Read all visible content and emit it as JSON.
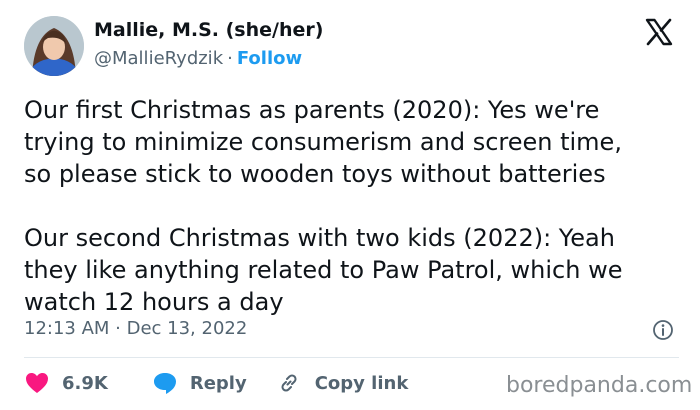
{
  "author": {
    "display_name": "Mallie, M.S. (she/her)",
    "handle": "@MallieRydzik",
    "separator": "·",
    "follow_label": "Follow"
  },
  "tweet": {
    "text": "Our first Christmas as parents (2020): Yes we're\ntrying to minimize consumerism and screen time,\nso please stick to wooden toys without batteries\n\nOur second Christmas with two kids (2022): Yeah\nthey like anything related to Paw Patrol, which we\nwatch 12 hours a day",
    "timestamp": "12:13 AM · Dec 13, 2022"
  },
  "actions": {
    "like_count": "6.9K",
    "reply_label": "Reply",
    "copy_link_label": "Copy link"
  },
  "watermark": "boredpanda.com",
  "icons": [
    "x-logo-icon",
    "info-icon",
    "heart-icon",
    "reply-bubble-icon",
    "link-icon"
  ],
  "colors": {
    "text": "#0f1419",
    "secondary": "#536471",
    "accent": "#1d9bf0",
    "like": "#f91880"
  }
}
